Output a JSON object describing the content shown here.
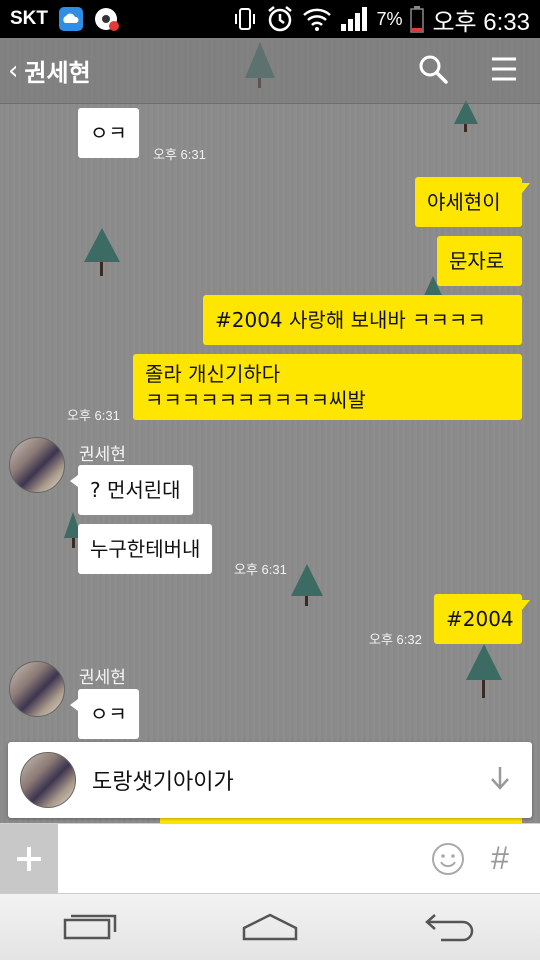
{
  "status_bar": {
    "carrier": "SKT",
    "battery_percent": "7%",
    "time": "오후 6:33"
  },
  "header": {
    "back_chevron": "‹",
    "title": "권세현"
  },
  "messages": [
    {
      "id": "m1",
      "direction": "in",
      "text": "ㅇㅋ",
      "time": "오후 6:31"
    },
    {
      "id": "m2",
      "direction": "out",
      "text": "야세현이"
    },
    {
      "id": "m3",
      "direction": "out",
      "text": "문자로"
    },
    {
      "id": "m4",
      "direction": "out",
      "text": "#2004 사랑해 보내바 ㅋㅋㅋㅋ"
    },
    {
      "id": "m5",
      "direction": "out",
      "lines": [
        "졸라 개신기하다",
        "ㅋㅋㅋㅋㅋㅋㅋㅋㅋㅋ씨발"
      ],
      "time": "오후 6:31"
    },
    {
      "id": "m6",
      "direction": "in",
      "sender": "권세현",
      "text": "? 먼서린대"
    },
    {
      "id": "m7",
      "direction": "in",
      "text": "누구한테버내",
      "time": "오후 6:31"
    },
    {
      "id": "m8",
      "direction": "out",
      "text": "#2004",
      "time": "오후 6:32"
    },
    {
      "id": "m9",
      "direction": "in",
      "sender": "권세현",
      "text": "ㅇㅋ"
    }
  ],
  "notice": {
    "text": "도랑샛기아이가"
  },
  "input": {
    "value": "",
    "hash_label": "#"
  },
  "colors": {
    "outgoing_bubble": "#ffe600",
    "incoming_bubble": "#ffffff",
    "wallpaper": "#8e8e8e"
  }
}
